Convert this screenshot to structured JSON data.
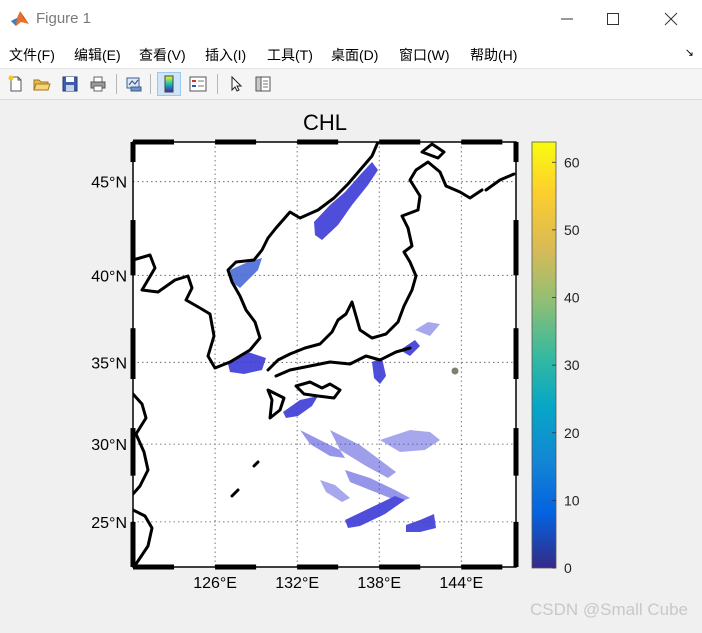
{
  "window": {
    "title": "Figure 1",
    "buttons": [
      "minimize",
      "maximize",
      "close"
    ]
  },
  "menu": {
    "items": [
      "文件(F)",
      "编辑(E)",
      "查看(V)",
      "插入(I)",
      "工具(T)",
      "桌面(D)",
      "窗口(W)",
      "帮助(H)"
    ],
    "dock_arrow": "↘"
  },
  "toolbar": {
    "buttons": [
      {
        "name": "new-figure",
        "icon": "new-file-icon",
        "active": false
      },
      {
        "name": "open",
        "icon": "open-folder-icon",
        "active": false
      },
      {
        "name": "save",
        "icon": "save-icon",
        "active": false
      },
      {
        "name": "print",
        "icon": "print-icon",
        "active": false
      },
      {
        "name": "link-plot",
        "icon": "link-plot-icon",
        "active": false
      },
      {
        "name": "insert-colorbar",
        "icon": "colorbar-icon",
        "active": true
      },
      {
        "name": "insert-legend",
        "icon": "legend-icon",
        "active": false
      },
      {
        "name": "edit-plot",
        "icon": "pointer-arrow-icon",
        "active": false
      },
      {
        "name": "property-inspector",
        "icon": "panel-icon",
        "active": false
      }
    ]
  },
  "chart_data": {
    "type": "heatmap",
    "title": "CHL",
    "projection": "mercator",
    "lon_range": [
      120,
      148
    ],
    "lat_range": [
      22,
      47
    ],
    "x_ticks": [
      "126°E",
      "132°E",
      "138°E",
      "144°E"
    ],
    "x_tick_values": [
      126,
      132,
      138,
      144
    ],
    "y_ticks": [
      "25°N",
      "30°N",
      "35°N",
      "40°N",
      "45°N"
    ],
    "y_tick_values": [
      25,
      30,
      35,
      40,
      45
    ],
    "grid": true,
    "grid_style": "dotted",
    "colorbar": {
      "colormap": "parula",
      "min": 0,
      "max": 63,
      "ticks": [
        "0",
        "10",
        "20",
        "30",
        "40",
        "50",
        "60"
      ],
      "tick_values": [
        0,
        10,
        20,
        30,
        40,
        50,
        60
      ],
      "location": "right"
    },
    "coastline_color": "#000000",
    "frame_color": "#000000",
    "data_color_dominant": "#3b3bd6",
    "marker_color": "#808070"
  },
  "watermark": "CSDN @Small Cube"
}
